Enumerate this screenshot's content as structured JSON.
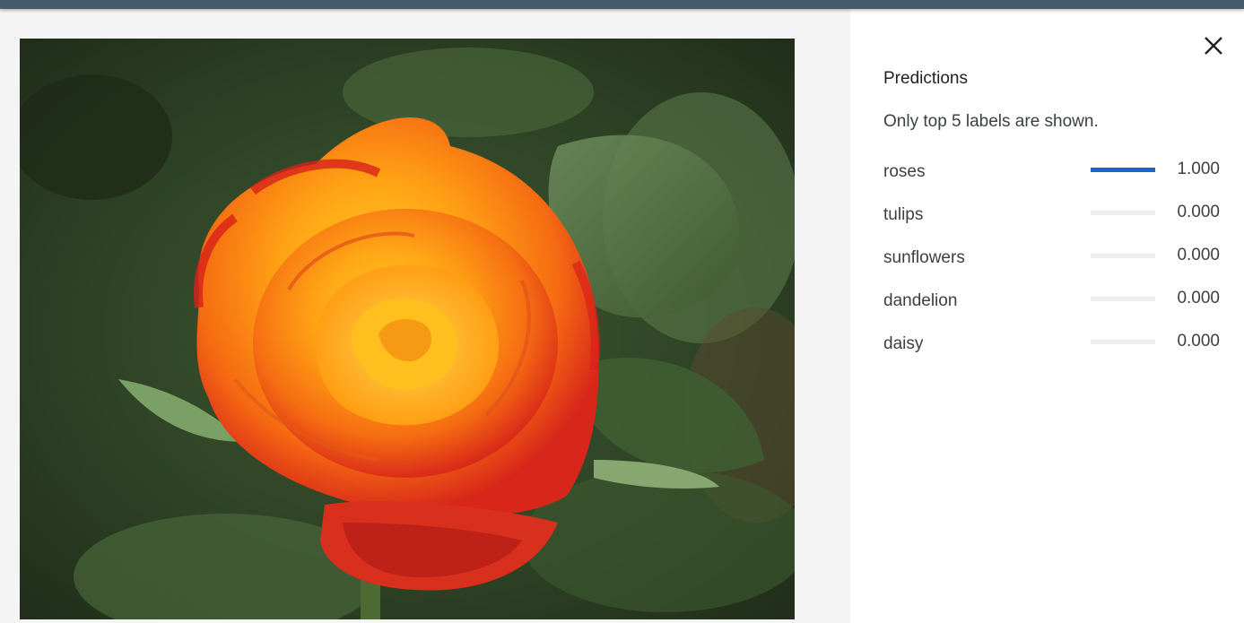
{
  "header": {
    "bar_color": "#455a6a"
  },
  "photo": {
    "subject": "orange-red rose",
    "icon": "rose-photo"
  },
  "panel": {
    "close_icon": "close-icon",
    "title": "Predictions",
    "note": "Only top 5 labels are shown.",
    "bar_color": "#1a66cc",
    "predictions": [
      {
        "label": "roses",
        "score": "1.000",
        "value": 1.0
      },
      {
        "label": "tulips",
        "score": "0.000",
        "value": 0.0
      },
      {
        "label": "sunflowers",
        "score": "0.000",
        "value": 0.0
      },
      {
        "label": "dandelion",
        "score": "0.000",
        "value": 0.0
      },
      {
        "label": "daisy",
        "score": "0.000",
        "value": 0.0
      }
    ]
  }
}
